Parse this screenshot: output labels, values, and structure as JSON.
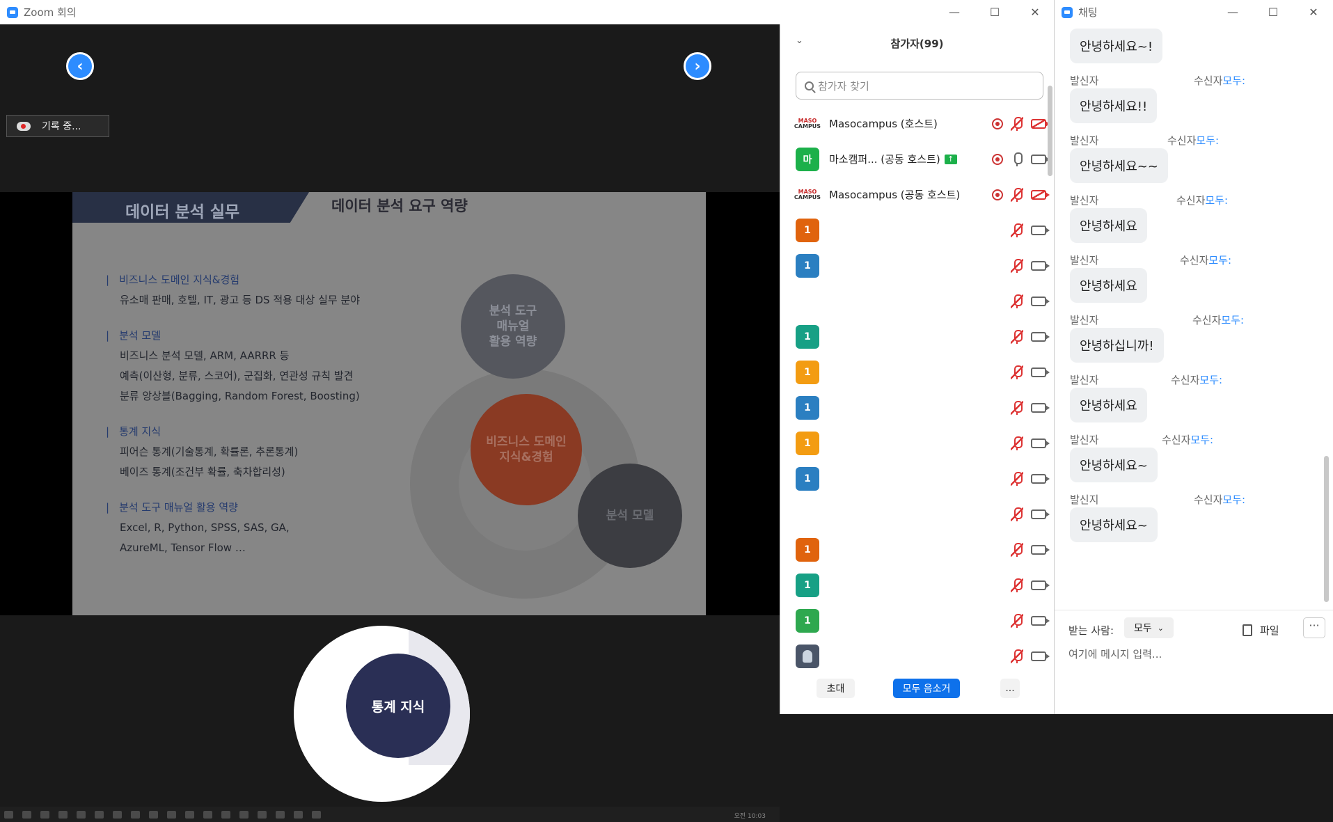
{
  "zoom_window": {
    "title": "Zoom 회의",
    "recording_label": "기록 중...",
    "nav_prev": "‹",
    "nav_next": "›"
  },
  "slide": {
    "header_left": "데이터 분석 실무",
    "header_right": "데이터 분석 요구 역량",
    "groups": [
      {
        "head": "비즈니스 도메인 지식&경험",
        "lines": [
          "유소매 판매, 호텔, IT, 광고 등 DS 적용 대상 실무 분야"
        ]
      },
      {
        "head": "분석 모델",
        "lines": [
          "비즈니스 분석 모델, ARM, AARRR 등",
          "예측(이산형, 분류, 스코어), 군집화, 연관성 규칙 발견",
          "분류 앙상블(Bagging, Random Forest, Boosting)"
        ]
      },
      {
        "head": "통계 지식",
        "lines": [
          "피어슨 통계(기술통계, 확률론, 추론통계)",
          "베이즈 통계(조건부 확률, 축차합리성)"
        ]
      },
      {
        "head": "분석 도구 매뉴얼 활용 역량",
        "lines": [
          "Excel, R, Python, SPSS, SAS, GA,",
          "AzureML, Tensor Flow …"
        ]
      }
    ],
    "circle_top": "분석 도구\n매뉴얼\n활용 역량",
    "circle_center": "비즈니스 도메인\n지식&경험",
    "circle_right": "분석 모델",
    "circle_magnified": "통계 지식",
    "taskbar_clock": "오전 10:03"
  },
  "participants": {
    "title": "참가자(99)",
    "search_placeholder": "참가자 찾기",
    "rows": [
      {
        "avatar": "MASO CAMPUS",
        "avatar_color": "#ffffff",
        "name": "Masocampus (호스트)",
        "rec": true,
        "mic": "muted",
        "video": "off"
      },
      {
        "avatar": "마",
        "avatar_color": "#1cb04a",
        "name": "마소캠퍼...  (공동 호스트)",
        "rec": true,
        "mic": "on",
        "video": "on",
        "sharing": true
      },
      {
        "avatar": "MASO CAMPUS",
        "avatar_color": "#ffffff",
        "name": "Masocampus (공동 호스트)",
        "rec": true,
        "mic": "muted",
        "video": "off"
      },
      {
        "avatar": "1",
        "avatar_color": "#e0630d",
        "name": "",
        "mic": "muted",
        "video": "on"
      },
      {
        "avatar": "1",
        "avatar_color": "#2b7fc1",
        "name": "",
        "mic": "muted",
        "video": "on"
      },
      {
        "avatar": "",
        "avatar_color": "",
        "name": "",
        "mic": "muted",
        "video": "on"
      },
      {
        "avatar": "1",
        "avatar_color": "#17a085",
        "name": "",
        "mic": "muted",
        "video": "on"
      },
      {
        "avatar": "1",
        "avatar_color": "#f39c12",
        "name": "",
        "mic": "muted",
        "video": "on"
      },
      {
        "avatar": "1",
        "avatar_color": "#2b7fc1",
        "name": "",
        "mic": "muted",
        "video": "on"
      },
      {
        "avatar": "1",
        "avatar_color": "#f39c12",
        "name": "",
        "mic": "muted",
        "video": "on"
      },
      {
        "avatar": "1",
        "avatar_color": "#2b7fc1",
        "name": "",
        "mic": "muted",
        "video": "on"
      },
      {
        "avatar": "",
        "avatar_color": "",
        "name": "",
        "mic": "muted",
        "video": "on"
      },
      {
        "avatar": "1",
        "avatar_color": "#e0630d",
        "name": "",
        "mic": "muted",
        "video": "on"
      },
      {
        "avatar": "1",
        "avatar_color": "#17a085",
        "name": "",
        "mic": "muted",
        "video": "on"
      },
      {
        "avatar": "1",
        "avatar_color": "#2ea84f",
        "name": "",
        "mic": "muted",
        "video": "on"
      },
      {
        "avatar": "person",
        "avatar_color": "#4a5568",
        "name": "",
        "mic": "muted",
        "video": "on"
      }
    ],
    "invite_label": "초대",
    "mute_all_label": "모두 음소거",
    "more_label": "..."
  },
  "chat": {
    "title": "채팅",
    "sender_label": "발신자",
    "recipient_prefix": "수신자",
    "recipient_name": "모두:",
    "messages": [
      {
        "from": "",
        "text": "안녕하세요~!"
      },
      {
        "from": "발신자",
        "text": "안녕하세요!!"
      },
      {
        "from": "발신자",
        "text": "안녕하세요~~"
      },
      {
        "from": "발신자",
        "text": "안녕하세요"
      },
      {
        "from": "발신자",
        "text": "안녕하세요"
      },
      {
        "from": "발신자",
        "text": "안녕하십니까!"
      },
      {
        "from": "발신자",
        "text": "안녕하세요"
      },
      {
        "from": "발신자",
        "text": "안녕하세요~"
      },
      {
        "from": "발신지",
        "text": "안녕하세요~"
      }
    ],
    "to_label": "받는 사람:",
    "to_value": "모두",
    "file_label": "파일",
    "more_label": "···",
    "input_placeholder": "여기에 메시지 입력..."
  }
}
